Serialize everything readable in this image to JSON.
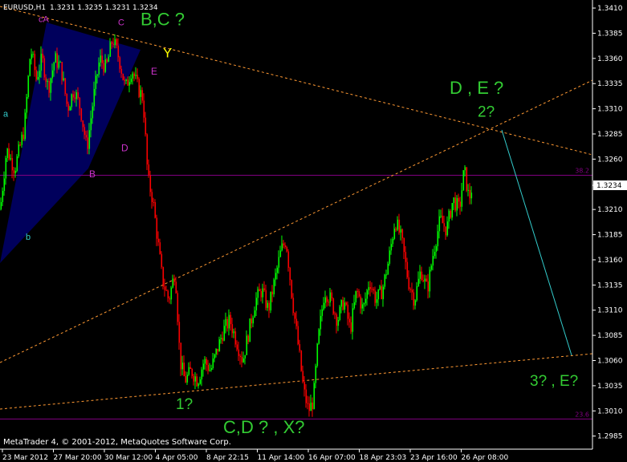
{
  "header": {
    "symbol_timeframe": "EURUSD,H1",
    "ohlc": "1.3231 1.3235 1.3231 1.3234"
  },
  "footer": {
    "copyright": "MetaTrader 4, © 2001-2012, MetaQuotes Software Corp."
  },
  "colors": {
    "background": "#000000",
    "bull_candle": "#00ff00",
    "bear_candle": "#ff0000",
    "wave_green": "#33cc33",
    "wave_cyan": "#33cccc",
    "wave_magenta": "#cc33cc",
    "wave_yellow": "#ffff00",
    "trendline_orange": "#ff9933",
    "fib_line": "#800080",
    "channel_fill": "#000066",
    "price_box": "#ffffff"
  },
  "chart_data": {
    "type": "candlestick",
    "symbol": "EURUSD",
    "timeframe": "H1",
    "ylim": [
      1.2972,
      1.3418
    ],
    "y_ticks": [
      "1.3410",
      "1.3385",
      "1.3360",
      "1.3335",
      "1.3310",
      "1.3285",
      "1.3260",
      "1.3234",
      "1.3210",
      "1.3185",
      "1.3160",
      "1.3135",
      "1.3110",
      "1.3085",
      "1.3060",
      "1.3035",
      "1.3010",
      "1.2985"
    ],
    "current_price": "1.3234",
    "x_ticks": [
      "23 Mar 2012",
      "27 Mar 20:00",
      "30 Mar 12:00",
      "4 Apr 05:00",
      "8 Apr 22:15",
      "11 Apr 14:00",
      "16 Apr 07:00",
      "18 Apr 23:03",
      "23 Apr 16:00",
      "26 Apr 08:00"
    ],
    "fib_levels": [
      {
        "label": "38.2",
        "price": 1.3244
      },
      {
        "label": "23.6",
        "price": 1.3002
      }
    ],
    "close_path": [
      [
        0,
        1.321
      ],
      [
        8,
        1.327
      ],
      [
        18,
        1.325
      ],
      [
        30,
        1.329
      ],
      [
        38,
        1.337
      ],
      [
        45,
        1.334
      ],
      [
        52,
        1.336
      ],
      [
        60,
        1.333
      ],
      [
        68,
        1.336
      ],
      [
        76,
        1.335
      ],
      [
        84,
        1.331
      ],
      [
        92,
        1.333
      ],
      [
        100,
        1.331
      ],
      [
        108,
        1.327
      ],
      [
        116,
        1.332
      ],
      [
        124,
        1.336
      ],
      [
        132,
        1.335
      ],
      [
        140,
        1.338
      ],
      [
        148,
        1.336
      ],
      [
        156,
        1.333
      ],
      [
        164,
        1.335
      ],
      [
        172,
        1.333
      ],
      [
        178,
        1.332
      ],
      [
        184,
        1.324
      ],
      [
        190,
        1.322
      ],
      [
        196,
        1.318
      ],
      [
        202,
        1.314
      ],
      [
        210,
        1.312
      ],
      [
        218,
        1.315
      ],
      [
        224,
        1.306
      ],
      [
        230,
        1.304
      ],
      [
        238,
        1.305
      ],
      [
        246,
        1.304
      ],
      [
        254,
        1.306
      ],
      [
        262,
        1.305
      ],
      [
        270,
        1.307
      ],
      [
        278,
        1.309
      ],
      [
        286,
        1.31
      ],
      [
        294,
        1.308
      ],
      [
        302,
        1.306
      ],
      [
        310,
        1.309
      ],
      [
        318,
        1.312
      ],
      [
        326,
        1.313
      ],
      [
        334,
        1.311
      ],
      [
        342,
        1.314
      ],
      [
        350,
        1.317
      ],
      [
        356,
        1.318
      ],
      [
        364,
        1.312
      ],
      [
        372,
        1.307
      ],
      [
        378,
        1.303
      ],
      [
        384,
        1.301
      ],
      [
        390,
        1.302
      ],
      [
        396,
        1.308
      ],
      [
        404,
        1.313
      ],
      [
        412,
        1.312
      ],
      [
        420,
        1.31
      ],
      [
        428,
        1.312
      ],
      [
        436,
        1.309
      ],
      [
        444,
        1.313
      ],
      [
        452,
        1.311
      ],
      [
        460,
        1.314
      ],
      [
        468,
        1.312
      ],
      [
        476,
        1.313
      ],
      [
        484,
        1.316
      ],
      [
        492,
        1.32
      ],
      [
        500,
        1.318
      ],
      [
        508,
        1.314
      ],
      [
        516,
        1.312
      ],
      [
        524,
        1.315
      ],
      [
        532,
        1.313
      ],
      [
        540,
        1.317
      ],
      [
        548,
        1.32
      ],
      [
        556,
        1.319
      ],
      [
        564,
        1.322
      ],
      [
        572,
        1.321
      ],
      [
        578,
        1.325
      ],
      [
        584,
        1.322
      ],
      [
        588,
        1.3234
      ]
    ]
  },
  "annotations": [
    {
      "text": "B,C ?",
      "color": "wave_green",
      "size": 22,
      "price": 1.3393,
      "xpx": 175
    },
    {
      "text": "Y",
      "color": "wave_yellow",
      "size": 17,
      "price": 1.3361,
      "xpx": 203
    },
    {
      "text": "cA",
      "color": "wave_magenta",
      "size": 11,
      "price": 1.3396,
      "xpx": 48
    },
    {
      "text": "C",
      "color": "wave_magenta",
      "size": 11,
      "price": 1.3393,
      "xpx": 147
    },
    {
      "text": "E",
      "color": "wave_magenta",
      "size": 12,
      "price": 1.3344,
      "xpx": 188
    },
    {
      "text": "D",
      "color": "wave_magenta",
      "size": 12,
      "price": 1.3268,
      "xpx": 151
    },
    {
      "text": "B",
      "color": "wave_magenta",
      "size": 12,
      "price": 1.3242,
      "xpx": 111
    },
    {
      "text": "a",
      "color": "wave_cyan",
      "size": 11,
      "price": 1.3302,
      "xpx": 4
    },
    {
      "text": "b",
      "color": "wave_cyan",
      "size": 11,
      "price": 1.318,
      "xpx": 32
    },
    {
      "text": "D , E ?",
      "color": "wave_green",
      "size": 22,
      "price": 1.3325,
      "xpx": 560
    },
    {
      "text": "2?",
      "color": "wave_green",
      "size": 19,
      "price": 1.3302,
      "xpx": 595
    },
    {
      "text": "1?",
      "color": "wave_green",
      "size": 19,
      "price": 1.3012,
      "xpx": 219
    },
    {
      "text": "C,D ? , X?",
      "color": "wave_green",
      "size": 22,
      "price": 1.2988,
      "xpx": 278
    },
    {
      "text": "3? , E?",
      "color": "wave_green",
      "size": 19,
      "price": 1.3035,
      "xpx": 660
    }
  ]
}
